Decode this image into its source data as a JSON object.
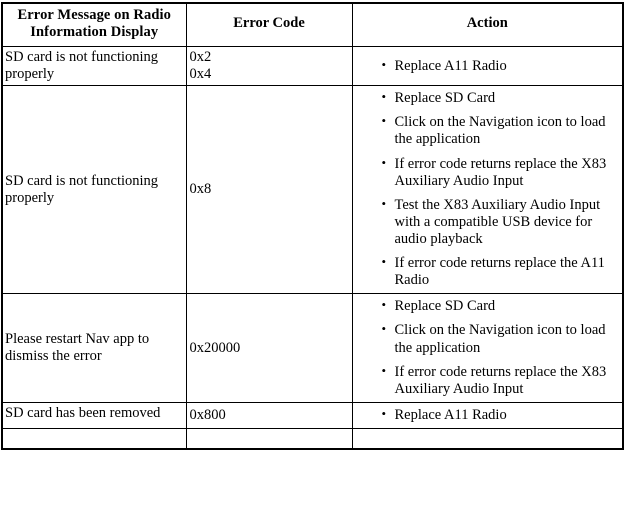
{
  "table": {
    "headers": [
      "Error Message on Radio Information Display",
      "Error Code",
      "Action"
    ],
    "rows": [
      {
        "message": "SD card is not functioning properly",
        "code": "0x2\n0x4",
        "message_align": "top",
        "code_align": "top",
        "actions": [
          "Replace A11 Radio"
        ]
      },
      {
        "message": "SD card is not functioning properly",
        "code": "0x8",
        "message_align": "middle",
        "code_align": "middle",
        "actions": [
          "Replace SD Card",
          "Click on the Navigation icon to load the application",
          "If error code returns replace the X83 Auxiliary Audio Input",
          "Test the X83 Auxiliary Audio Input with a compatible USB device for audio playback",
          "If error code returns replace the A11 Radio"
        ]
      },
      {
        "message": "Please restart Nav app to dismiss the error",
        "code": "0x20000",
        "message_align": "middle",
        "code_align": "middle",
        "actions": [
          "Replace SD Card",
          "Click on the Navigation icon to load the application",
          "If error code returns replace the X83 Auxiliary Audio Input"
        ]
      },
      {
        "message": "SD card has been removed",
        "code": "0x800",
        "message_align": "top",
        "code_align": "middle",
        "actions": [
          "Replace A11 Radio"
        ]
      }
    ],
    "partial_row": {
      "message": "",
      "code": "",
      "actions": []
    }
  }
}
